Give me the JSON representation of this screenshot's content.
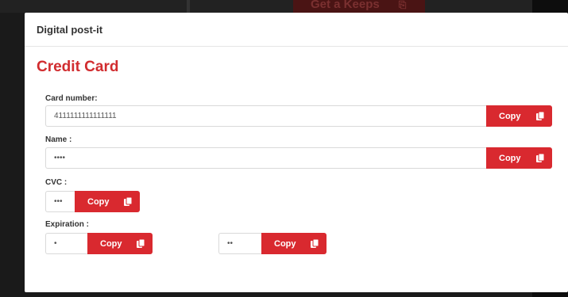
{
  "background": {
    "button_label": "Get a Keeps"
  },
  "modal": {
    "title": "Digital post-it",
    "section_title": "Credit Card",
    "fields": {
      "card_number": {
        "label": "Card number:",
        "value": "4111111111111111",
        "copy_label": "Copy"
      },
      "name": {
        "label": "Name :",
        "value": "••••",
        "copy_label": "Copy"
      },
      "cvc": {
        "label": "CVC :",
        "value": "•••",
        "copy_label": "Copy"
      },
      "expiration": {
        "label": "Expiration :",
        "month": {
          "value": "•",
          "copy_label": "Copy"
        },
        "year": {
          "value": "••",
          "copy_label": "Copy"
        }
      }
    }
  },
  "icons": {
    "copy": "copy-icon"
  },
  "colors": {
    "accent": "#d9292f",
    "title": "#d12c2f"
  }
}
